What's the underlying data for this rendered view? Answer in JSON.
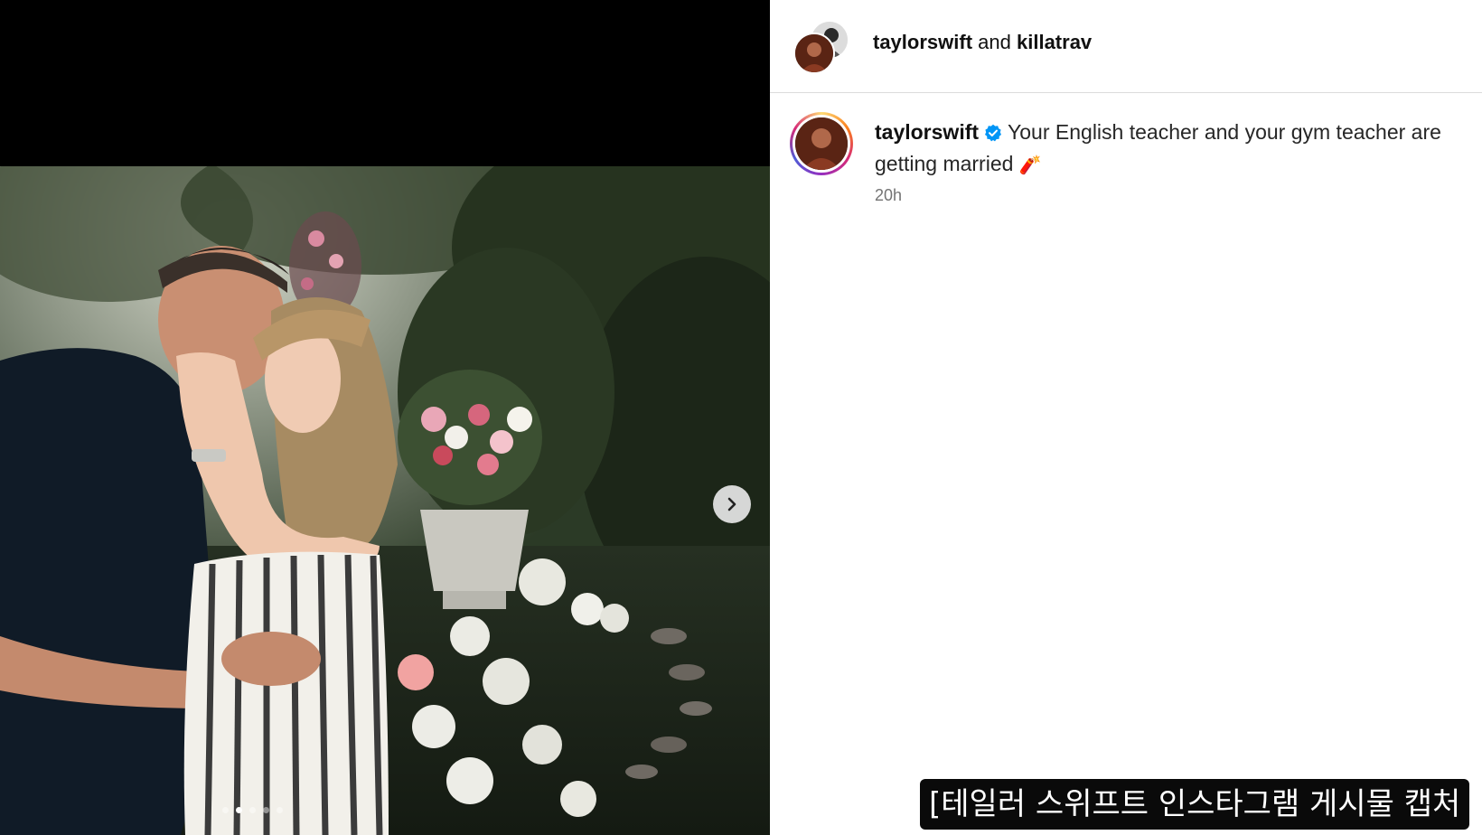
{
  "post": {
    "header": {
      "user1": "taylorswift",
      "conjunction": "and",
      "user2": "killatrav"
    },
    "caption": {
      "username": "taylorswift",
      "text": "Your English teacher and your gym teacher are getting married",
      "emoji": "🧨",
      "time": "20h"
    },
    "carousel": {
      "slide_count": 5,
      "active_slide": 2,
      "next_icon": "chevron-right-icon"
    }
  },
  "subtitle": "[테일러 스위프트 인스타그램 게시물 캡처",
  "colors": {
    "verified": "#0095f6",
    "story_ring": [
      "#feda75",
      "#fa7e1e",
      "#d62976",
      "#962fbf",
      "#4f5bd5"
    ]
  }
}
